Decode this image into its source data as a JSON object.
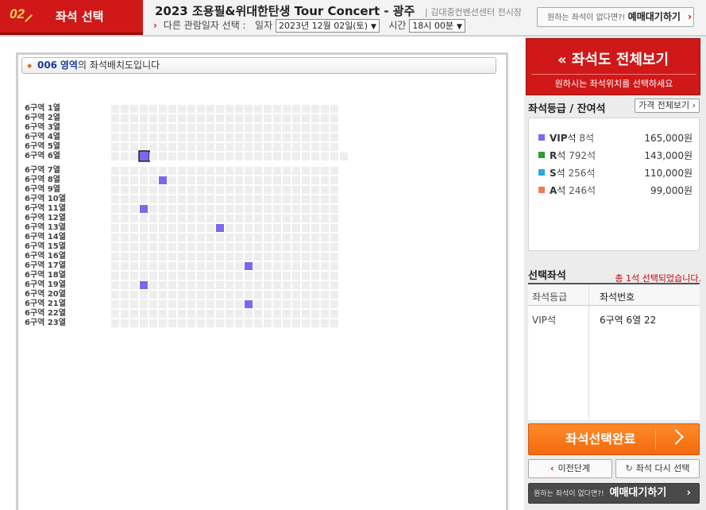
{
  "header": {
    "step_number": "02",
    "step_title": "좌석 선택",
    "concert_title": "2023 조용필&위대한탄생 Tour Concert - 광주",
    "venue": "| 김대중컨벤션센터 전시장",
    "other_date_label": "다른 관람일자 선택 :",
    "date_label": "일자",
    "date_value": "2023년 12월 02일(토)",
    "time_label": "시간",
    "time_value": "18시 00분",
    "wait_prefix": "원하는 좌석이 없다면?!",
    "wait_label": "예매대기하기"
  },
  "seatmap": {
    "zone_number": "006",
    "zone_word": "영역",
    "header_suffix": "의 좌석배치도입니다",
    "rows": [
      "6구역 1열",
      "6구역 2열",
      "6구역 3열",
      "6구역 4열",
      "6구역 5열",
      "6구역 6열",
      "6구역 7열",
      "6구역 8열",
      "6구역 9열",
      "6구역 10열",
      "6구역 11열",
      "6구역 12열",
      "6구역 13열",
      "6구역 14열",
      "6구역 15열",
      "6구역 16열",
      "6구역 17열",
      "6구역 18열",
      "6구역 19열",
      "6구역 20열",
      "6구역 21열",
      "6구역 22열",
      "6구역 23열"
    ],
    "seats_per_row": 24,
    "row6_seats": 25,
    "available_seats": [
      {
        "row": 8,
        "col": 5
      },
      {
        "row": 11,
        "col": 3
      },
      {
        "row": 13,
        "col": 11
      },
      {
        "row": 17,
        "col": 14
      },
      {
        "row": 19,
        "col": 3
      },
      {
        "row": 21,
        "col": 14
      }
    ],
    "selected_seat": {
      "row": 6,
      "col": 3
    },
    "colors": {
      "empty": "#eeeeee",
      "vip": "#7b68ee",
      "selected_border": "#222222"
    }
  },
  "right_panel": {
    "full_view_title": "좌석도 전체보기",
    "full_view_sub": "원하시는 좌석위치를 선택하세요",
    "grade_heading": "좌석등급 / 잔여석",
    "price_all_label": "가격 전체보기",
    "grades": [
      {
        "letter": "VIP",
        "suffix": "석",
        "remaining": "8석",
        "price": "165,000원",
        "color": "#7b68ee"
      },
      {
        "letter": "R",
        "suffix": "석",
        "remaining": "792석",
        "price": "143,000원",
        "color": "#2e9e2e"
      },
      {
        "letter": "S",
        "suffix": "석",
        "remaining": "256석",
        "price": "110,000원",
        "color": "#27a9e1"
      },
      {
        "letter": "A",
        "suffix": "석",
        "remaining": "246석",
        "price": "99,000원",
        "color": "#f27b50"
      }
    ],
    "selected_heading": "선택좌석",
    "selected_count_text": "총 1석 선택되었습니다.",
    "col_grade": "좌석등급",
    "col_seat": "좌석번호",
    "selected_grade": "VIP석",
    "selected_seat_text": "6구역 6열 22",
    "done_label": "좌석선택완료",
    "prev_label": "이전단계",
    "reselect_label": "좌석 다시 선택",
    "wait_prefix": "원하는 좌석이 없다면?!",
    "wait_label": "예매대기하기"
  }
}
